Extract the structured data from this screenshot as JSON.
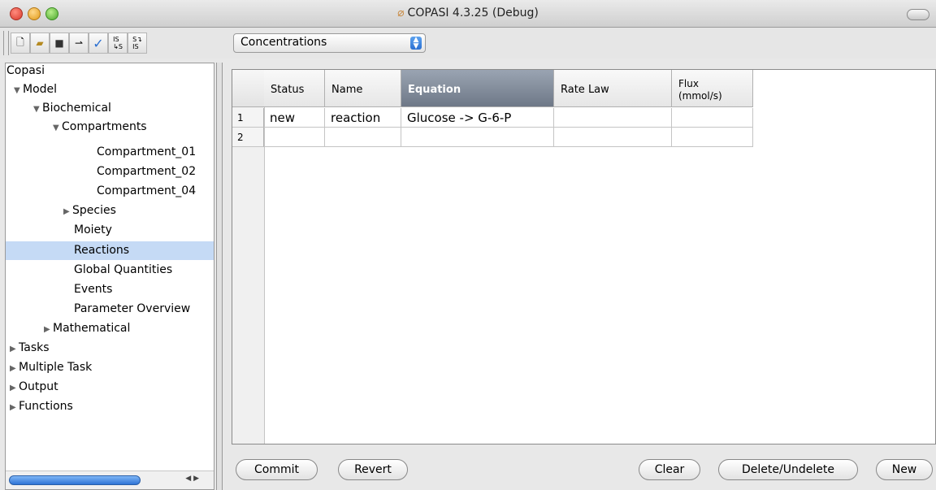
{
  "window": {
    "title": "COPASI 4.3.25 (Debug)",
    "title_icon": "copasi-logo-icon"
  },
  "toolbar": {
    "buttons": [
      {
        "name": "new-document-icon",
        "glyph": "🗋"
      },
      {
        "name": "open-folder-icon",
        "glyph": "📂"
      },
      {
        "name": "save-icon",
        "glyph": "💾"
      },
      {
        "name": "reaction-arrow-icon",
        "glyph": "⇀"
      },
      {
        "name": "check-icon",
        "glyph": "✓"
      },
      {
        "name": "import-sbml-icon",
        "glyph": "IS↳S"
      },
      {
        "name": "export-sbml-icon",
        "glyph": "S↴IS"
      }
    ],
    "unit_select": "Concentrations"
  },
  "tree": {
    "root": "Copasi",
    "items": [
      {
        "label": "Model",
        "expanded": true
      },
      {
        "label": "Biochemical",
        "expanded": true
      },
      {
        "label": "Compartments",
        "expanded": true
      },
      {
        "label": "Compartment_01"
      },
      {
        "label": "Compartment_02"
      },
      {
        "label": "Compartment_04"
      },
      {
        "label": "Species",
        "expanded": false
      },
      {
        "label": "Moiety"
      },
      {
        "label": "Reactions",
        "selected": true
      },
      {
        "label": "Global Quantities"
      },
      {
        "label": "Events"
      },
      {
        "label": "Parameter Overview"
      },
      {
        "label": "Mathematical",
        "expanded": false
      },
      {
        "label": "Tasks",
        "expanded": false
      },
      {
        "label": "Multiple Task",
        "expanded": false
      },
      {
        "label": "Output",
        "expanded": false
      },
      {
        "label": "Functions",
        "expanded": false
      }
    ]
  },
  "table": {
    "columns": [
      "Status",
      "Name",
      "Equation",
      "Rate Law",
      "Flux\n(mmol/s)"
    ],
    "sorted_column": "Equation",
    "rows": [
      {
        "num": "1",
        "cells": [
          "new",
          "reaction",
          "Glucose -> G-6-P",
          "",
          ""
        ]
      },
      {
        "num": "2",
        "cells": [
          "",
          "",
          "",
          "",
          ""
        ]
      }
    ]
  },
  "buttons": {
    "commit": "Commit",
    "revert": "Revert",
    "clear": "Clear",
    "delete_undelete": "Delete/Undelete",
    "new": "New"
  },
  "colors": {
    "selection": "#c5daf5",
    "sorted_header": "#7d8797",
    "close": "#d8382c",
    "minimize": "#e19a17",
    "maximize": "#4aa62c"
  }
}
